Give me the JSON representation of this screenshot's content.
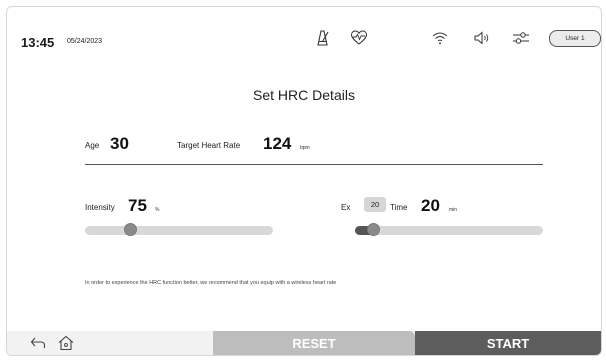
{
  "status": {
    "time": "13:45",
    "date": "05/24/2023",
    "user_label": "User 1"
  },
  "icons": [
    "metronome-icon",
    "heart-rate-icon",
    "wifi-icon",
    "volume-icon",
    "settings-sliders-icon",
    "back-icon",
    "home-icon"
  ],
  "title": "Set HRC Details",
  "age": {
    "label": "Age",
    "value": "30"
  },
  "target_hr": {
    "label": "Target Heart Rate",
    "value": "124",
    "unit": "bpm"
  },
  "intensity": {
    "label": "Intensity",
    "value": "75",
    "unit": "%",
    "slider_fraction": 0.24
  },
  "exercise_time": {
    "label_start": "Ex",
    "label_end": "Time",
    "value": "20",
    "unit": "min",
    "slider_fraction": 0.1,
    "tooltip": "20"
  },
  "note": "In order to experience the HRC function better, we recommend that you equip with a wireless heart rate",
  "buttons": {
    "reset": "RESET",
    "start": "START"
  },
  "colors": {
    "fill": "#555555",
    "track": "#d8d8d8",
    "reset_bg": "#bdbdbd",
    "start_bg": "#5d5d5d"
  }
}
